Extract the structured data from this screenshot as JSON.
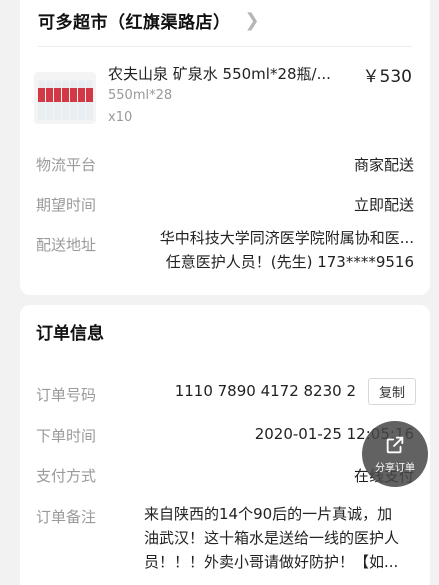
{
  "store": {
    "name": "可多超市（红旗渠路店）"
  },
  "product": {
    "title": "农夫山泉 矿泉水 550ml*28瓶/...",
    "price": "￥530",
    "spec": "550ml*28",
    "qty": "x10"
  },
  "delivery": {
    "logistics_label": "物流平台",
    "logistics_value": "商家配送",
    "time_label": "期望时间",
    "time_value": "立即配送",
    "address_label": "配送地址",
    "address_line1": "华中科技大学同济医学院附属协和医...",
    "address_line2": "任意医护人员！(先生) 173****9516"
  },
  "order": {
    "title": "订单信息",
    "number_label": "订单号码",
    "number_value": "1110 7890 4172 8230 2",
    "copy_label": "复制",
    "time_label": "下单时间",
    "time_value": "2020-01-25 12:05:16",
    "payment_label": "支付方式",
    "payment_value": "在线支付",
    "note_label": "订单备注",
    "note_line1": "来自陕西的14个90后的一片真诚，加",
    "note_line2": "油武汉！这十箱水是送给一线的医护人",
    "note_line3": "员！！！外卖小哥请做好防护！【如..."
  },
  "share": {
    "label": "分享订单",
    "icon": "share-icon"
  }
}
